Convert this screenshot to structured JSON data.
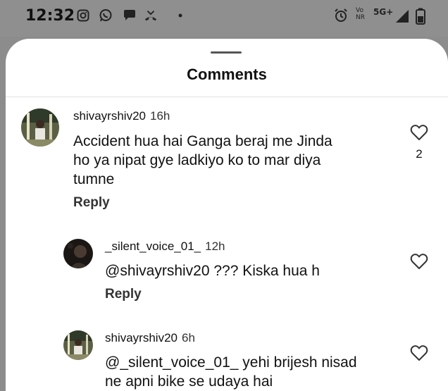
{
  "status_bar": {
    "time": "12:32",
    "left_icons": [
      "instagram-icon",
      "whatsapp-icon",
      "chat-bubble-icon",
      "missed-call-icon",
      "dot-icon"
    ],
    "network_line1": "Vo",
    "network_line2": "NR",
    "network_type": "5G+",
    "right_icons": [
      "alarm-icon",
      "signal-icon",
      "battery-icon"
    ]
  },
  "sheet": {
    "title": "Comments"
  },
  "comments": [
    {
      "username": "shivayrshiv20",
      "time": "16h",
      "text_lines": [
        "Accident hua hai Ganga beraj me Jinda",
        "ho ya nipat gye ladkiyo ko to mar diya",
        "tumne"
      ],
      "reply_label": "Reply",
      "likes": "2"
    },
    {
      "username": "_silent_voice_01_",
      "time": "12h",
      "text_lines": [
        "@shivayrshiv20 ??? Kiska hua h"
      ],
      "reply_label": "Reply"
    },
    {
      "username": "shivayrshiv20",
      "time": "6h",
      "text_lines": [
        "@_silent_voice_01_ yehi brijesh nisad",
        "ne apni bike se udaya hai"
      ]
    }
  ],
  "colors": {
    "status_bar_bg": "#8f8f8f",
    "sheet_bg": "#ffffff",
    "text": "#111111"
  }
}
